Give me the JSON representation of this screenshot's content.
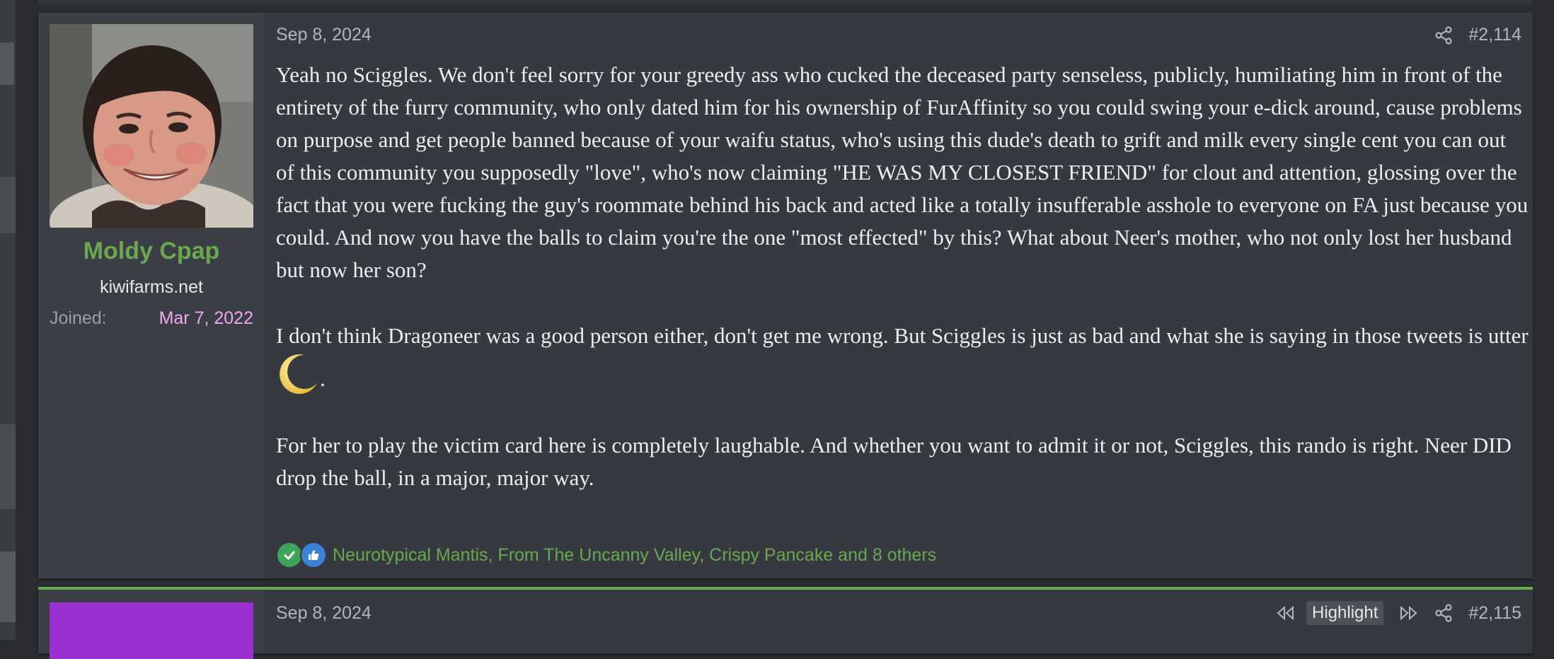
{
  "posts": [
    {
      "user": {
        "name": "Moldy Cpap",
        "title": "kiwifarms.net",
        "joined_label": "Joined:",
        "joined_date": "Mar 7, 2022"
      },
      "date": "Sep 8, 2024",
      "post_number": "#2,114",
      "message": {
        "p1": "Yeah no Sciggles. We don't feel sorry for your greedy ass who cucked the deceased party senseless, publicly, humiliating him in front of the entirety of the furry community, who only dated him for his ownership of FurAffinity so you could swing your e-dick around, cause problems on purpose and get people banned because of your waifu status, who's using this dude's death to grift and milk every single cent you can out of this community you supposedly \"love\", who's now claiming \"HE WAS MY CLOSEST FRIEND\" for clout and attention, glossing over the fact that you were fucking the guy's roommate behind his back and acted like a totally insufferable asshole to everyone on FA just because you could. And now you have the balls to claim you're the one \"most effected\" by this? What about Neer's mother, who not only lost her husband but now her son?",
        "p2_start": "I don't think Dragoneer was a good person either, don't get me wrong. But Sciggles is just as bad and what she is saying in those tweets is utter ",
        "p2_end": ".",
        "p2_emoji": "crescent-moon-icon",
        "p3": "For her to play the victim card here is completely laughable. And whether you want to admit it or not, Sciggles, this rando is right. Neer DID drop the ball, in a major, major way."
      },
      "reactions": {
        "icons": [
          "check-reaction-icon",
          "like-reaction-icon"
        ],
        "text": "Neurotypical Mantis, From The Uncanny Valley, Crispy Pancake and 8 others"
      }
    },
    {
      "date": "Sep 8, 2024",
      "post_number": "#2,115",
      "highlight_label": "Highlight"
    }
  ],
  "colors": {
    "username": "#6aa84f",
    "joined_date": "#f0a6f0",
    "post_bg": "#36393f",
    "user_col_bg": "#3b3f45",
    "avatar2": "#9b30d0"
  }
}
